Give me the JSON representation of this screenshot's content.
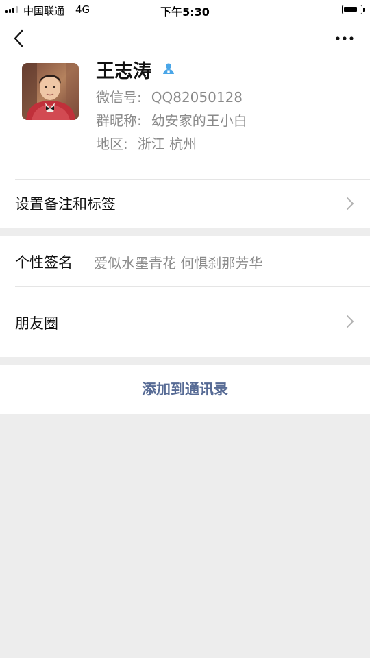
{
  "status_bar": {
    "carrier": "中国联通",
    "network": "4G",
    "time": "下午5:30"
  },
  "profile": {
    "name": "王志涛",
    "wechat_id_label": "微信号:",
    "wechat_id": "QQ82050128",
    "group_nickname_label": "群昵称:",
    "group_nickname": "幼安家的王小白",
    "region_label": "地区:",
    "region": "浙江  杭州",
    "icons": {
      "back": "chevron-left-icon",
      "more": "ellipsis-icon",
      "verify": "person-badge-icon"
    }
  },
  "rows": {
    "remark_label": "设置备注和标签",
    "signature_label": "个性签名",
    "signature_value": "爱似水墨青花 何惧刹那芳华",
    "moments_label": "朋友圈"
  },
  "actions": {
    "add_contact_label": "添加到通讯录"
  },
  "colors": {
    "accent_link": "#576b95",
    "verify_blue": "#4aa6e8",
    "secondary_text": "#8a8a8a",
    "page_background": "#ededed"
  }
}
